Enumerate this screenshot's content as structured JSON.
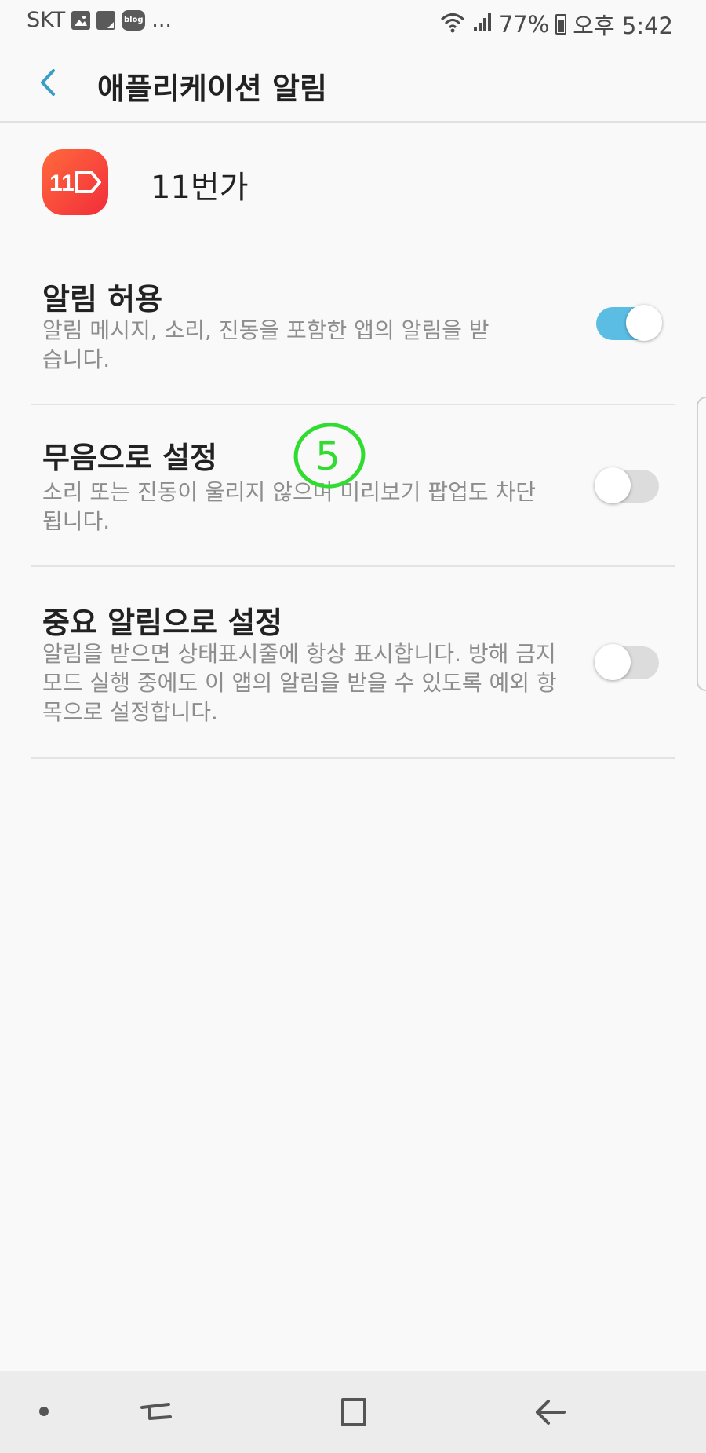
{
  "status_bar": {
    "carrier": "SKT",
    "blog_badge": "blog",
    "more_notifications": "...",
    "battery": "77%",
    "time": "오후 5:42"
  },
  "header": {
    "title": "애플리케이션 알림"
  },
  "app": {
    "name": "11번가",
    "icon_label": "11"
  },
  "settings": [
    {
      "title": "알림 허용",
      "description": "알림 메시지, 소리, 진동을 포함한 앱의 알림을 받습니다.",
      "enabled": true
    },
    {
      "title": "무음으로 설정",
      "description": "소리 또는 진동이 울리지 않으며 미리보기 팝업도 차단됩니다.",
      "enabled": false
    },
    {
      "title": "중요 알림으로 설정",
      "description": "알림을 받으면 상태표시줄에 항상 표시합니다. 방해 금지 모드 실행 중에도 이 앱의 알림을 받을 수 있도록 예외 항목으로 설정합니다.",
      "enabled": false
    }
  ],
  "annotation": {
    "text": "5",
    "color": "#2fdc2f"
  },
  "colors": {
    "accent": "#5bbde3",
    "back_arrow": "#3a9ec4",
    "app_icon": "#f4413a"
  },
  "icons": {
    "back": "chevron-left-icon",
    "nav_recents": "recents-icon",
    "nav_home": "home-icon",
    "nav_back": "back-arrow-icon"
  }
}
